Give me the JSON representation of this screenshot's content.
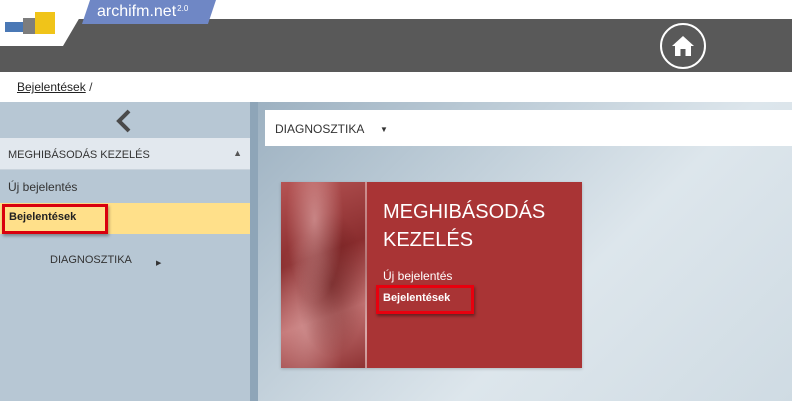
{
  "app": {
    "brand": "archifm.net",
    "version": "2.0"
  },
  "header": {
    "home_icon": "home-icon"
  },
  "breadcrumb": {
    "items": [
      "Bejelentések"
    ],
    "separator": "/"
  },
  "sidebar": {
    "collapse_icon": "chevron-left-icon",
    "section": {
      "label": "MEGHIBÁSODÁS KEZELÉS",
      "caret": "▲"
    },
    "items": [
      {
        "label": "Új bejelentés"
      },
      {
        "label": "Bejelentések",
        "active": true
      },
      {
        "label": "DIAGNOSZTIKA",
        "arrow": "▶"
      }
    ]
  },
  "main": {
    "dropdown": {
      "label": "DIAGNOSZTIKA",
      "caret": "▼"
    },
    "tile": {
      "title": "MEGHIBÁSODÁS KEZELÉS",
      "links": [
        {
          "label": "Új bejelentés"
        },
        {
          "label": "Bejelentések",
          "active": true
        }
      ]
    }
  },
  "colors": {
    "topbar": "#595959",
    "brand_tab": "#6f87c5",
    "sidebar": "#b7c7d4",
    "active_item": "#ffe08a",
    "highlight_border": "#d9000d",
    "tile": "#a93435"
  }
}
